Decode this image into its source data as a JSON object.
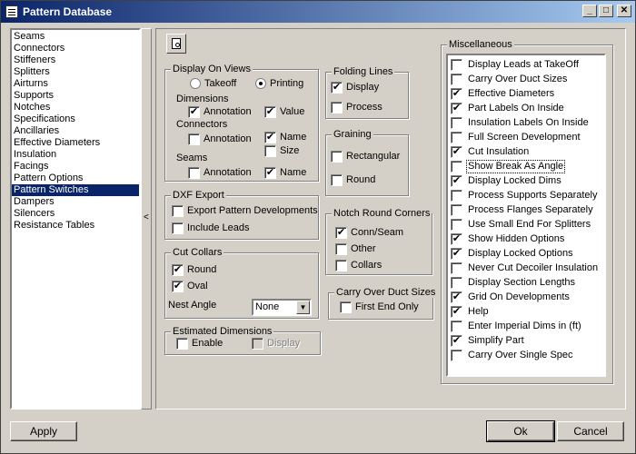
{
  "window": {
    "title": "Pattern Database"
  },
  "sidebar": {
    "items": [
      {
        "label": "Seams",
        "selected": false
      },
      {
        "label": "Connectors",
        "selected": false
      },
      {
        "label": "Stiffeners",
        "selected": false
      },
      {
        "label": "Splitters",
        "selected": false
      },
      {
        "label": "Airturns",
        "selected": false
      },
      {
        "label": "Supports",
        "selected": false
      },
      {
        "label": "Notches",
        "selected": false
      },
      {
        "label": "Specifications",
        "selected": false
      },
      {
        "label": "Ancillaries",
        "selected": false
      },
      {
        "label": "Effective Diameters",
        "selected": false
      },
      {
        "label": "Insulation",
        "selected": false
      },
      {
        "label": "Facings",
        "selected": false
      },
      {
        "label": "Pattern Options",
        "selected": false
      },
      {
        "label": "Pattern Switches",
        "selected": true
      },
      {
        "label": "Dampers",
        "selected": false
      },
      {
        "label": "Silencers",
        "selected": false
      },
      {
        "label": "Resistance Tables",
        "selected": false
      }
    ],
    "collapse_glyph": "<"
  },
  "display_on_views": {
    "title": "Display On Views",
    "takeoff_label": "Takeoff",
    "printing_label": "Printing",
    "selected_view": "Printing",
    "dimensions_label": "Dimensions",
    "dim_annotation_label": "Annotation",
    "dim_annotation_checked": true,
    "dim_value_label": "Value",
    "dim_value_checked": true,
    "connectors_label": "Connectors",
    "con_annotation_label": "Annotation",
    "con_annotation_checked": false,
    "con_name_label": "Name",
    "con_name_checked": true,
    "con_size_label": "Size",
    "con_size_checked": false,
    "seams_label": "Seams",
    "seam_annotation_label": "Annotation",
    "seam_annotation_checked": false,
    "seam_name_label": "Name",
    "seam_name_checked": true
  },
  "dxf_export": {
    "title": "DXF Export",
    "export_label": "Export Pattern Developments",
    "export_checked": false,
    "leads_label": "Include Leads",
    "leads_checked": false
  },
  "cut_collars": {
    "title": "Cut Collars",
    "round_label": "Round",
    "round_checked": true,
    "oval_label": "Oval",
    "oval_checked": true,
    "nest_angle_label": "Nest Angle",
    "nest_angle_value": "None"
  },
  "estimated_dimensions": {
    "title": "Estimated Dimensions",
    "enable_label": "Enable",
    "enable_checked": false,
    "display_label": "Display",
    "display_checked": false
  },
  "folding_lines": {
    "title": "Folding Lines",
    "display_label": "Display",
    "display_checked": true,
    "process_label": "Process",
    "process_checked": false
  },
  "graining": {
    "title": "Graining",
    "rectangular_label": "Rectangular",
    "rectangular_checked": false,
    "round_label": "Round",
    "round_checked": false
  },
  "notch_round_corners": {
    "title": "Notch Round Corners",
    "conn_seam_label": "Conn/Seam",
    "conn_seam_checked": true,
    "other_label": "Other",
    "other_checked": false,
    "collars_label": "Collars",
    "collars_checked": false
  },
  "carry_over_duct_sizes": {
    "title": "Carry Over Duct Sizes",
    "first_end_label": "First End Only",
    "first_end_checked": false
  },
  "miscellaneous": {
    "title": "Miscellaneous",
    "items": [
      {
        "label": "Display Leads at TakeOff",
        "checked": false,
        "focused": false
      },
      {
        "label": "Carry Over Duct Sizes",
        "checked": false,
        "focused": false
      },
      {
        "label": "Effective Diameters",
        "checked": true,
        "focused": false
      },
      {
        "label": "Part Labels On Inside",
        "checked": true,
        "focused": false
      },
      {
        "label": "Insulation Labels On Inside",
        "checked": false,
        "focused": false
      },
      {
        "label": "Full Screen Development",
        "checked": false,
        "focused": false
      },
      {
        "label": "Cut Insulation",
        "checked": true,
        "focused": false
      },
      {
        "label": "Show Break As Angle",
        "checked": false,
        "focused": true
      },
      {
        "label": "Display Locked Dims",
        "checked": true,
        "focused": false
      },
      {
        "label": "Process Supports Separately",
        "checked": false,
        "focused": false
      },
      {
        "label": "Process Flanges Separately",
        "checked": false,
        "focused": false
      },
      {
        "label": "Use Small End For Splitters",
        "checked": false,
        "focused": false
      },
      {
        "label": "Show Hidden Options",
        "checked": true,
        "focused": false
      },
      {
        "label": "Display Locked Options",
        "checked": true,
        "focused": false
      },
      {
        "label": "Never Cut Decoiler Insulation",
        "checked": false,
        "focused": false
      },
      {
        "label": "Display Section Lengths",
        "checked": false,
        "focused": false
      },
      {
        "label": "Grid On Developments",
        "checked": true,
        "focused": false
      },
      {
        "label": "Help",
        "checked": true,
        "focused": false
      },
      {
        "label": "Enter Imperial Dims in (ft)",
        "checked": false,
        "focused": false
      },
      {
        "label": "Simplify Part",
        "checked": true,
        "focused": false
      },
      {
        "label": "Carry Over Single Spec",
        "checked": false,
        "focused": false
      }
    ]
  },
  "buttons": {
    "apply": "Apply",
    "ok": "Ok",
    "cancel": "Cancel"
  },
  "icons": {
    "app": "window-icon",
    "preview": "magnifier-icon",
    "minimize": "minimize-icon",
    "maximize": "maximize-icon",
    "close": "close-icon"
  },
  "colors": {
    "selection": "#0a246a",
    "face": "#d4d0c8"
  }
}
